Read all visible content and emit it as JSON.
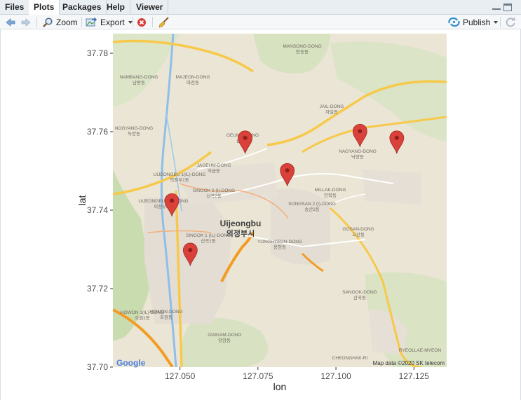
{
  "tabs": [
    {
      "label": "Files",
      "active": false
    },
    {
      "label": "Plots",
      "active": true
    },
    {
      "label": "Packages",
      "active": false
    },
    {
      "label": "Help",
      "active": false
    },
    {
      "label": "Viewer",
      "active": false
    }
  ],
  "toolbar": {
    "zoom_label": "Zoom",
    "export_label": "Export",
    "publish_label": "Publish"
  },
  "colors": {
    "map_land": "#ebe5d6",
    "road_major": "#f7c94b",
    "road_orange": "#f39c24",
    "river": "#8fbfe8",
    "park": "#c7dcae",
    "marker": "#d9413a",
    "publish_accent": "#2f8fd2"
  },
  "map": {
    "city_name": "Uijeongbu",
    "city_name_ko": "의정부시",
    "attribution": "Map data ©2020 SK telecom",
    "google_logo": "Google",
    "place_labels": [
      {
        "text": "MANSONG-DONG",
        "sub": "만송동"
      },
      {
        "text": "NAMBANG-DONG",
        "sub": "남방동"
      },
      {
        "text": "MAJEON-DONG",
        "sub": "마전동"
      },
      {
        "text": "JAIL-DONG",
        "sub": "자일동"
      },
      {
        "text": "NOGYANG-DONG",
        "sub": "녹양동"
      },
      {
        "text": "GEUMO-DONG",
        "sub": "금오동"
      },
      {
        "text": "NAGYANG-DONG",
        "sub": "낙양동"
      },
      {
        "text": "JAGEUM-DONG",
        "sub": "자금동"
      },
      {
        "text": "UIJEONGBU 1(IL)-DONG",
        "sub": "의정부1동"
      },
      {
        "text": "SINGOK 2 (I)-DONG",
        "sub": "신곡2동"
      },
      {
        "text": "MILLAK-DONG",
        "sub": "민락동"
      },
      {
        "text": "UIJEONGBU 2(I)-DONG",
        "sub": "의정부2동"
      },
      {
        "text": "SONGSAN 2 (I)-DONG",
        "sub": "송산2동"
      },
      {
        "text": "GOSAN-DONG",
        "sub": "고산동"
      },
      {
        "text": "SINGOK 1 (IL)-DONG",
        "sub": "신곡1동"
      },
      {
        "text": "YONGHYEON-DONG",
        "sub": "용현동"
      },
      {
        "text": "SANGOK-DONG",
        "sub": "산곡동"
      },
      {
        "text": "HOWON 1(IL)-DONG",
        "sub": "호원1동"
      },
      {
        "text": "HOWON-DONG",
        "sub": "호원동"
      },
      {
        "text": "JANGAM-DONG",
        "sub": "장암동"
      },
      {
        "text": "CHEONGHAK-RI",
        "sub": ""
      },
      {
        "text": "RYEOLLAE-MYEON",
        "sub": ""
      }
    ]
  },
  "chart_data": {
    "type": "scatter",
    "xlabel": "lon",
    "ylabel": "lat",
    "xlim": [
      127.0285,
      127.1355
    ],
    "ylim": [
      37.7,
      37.785
    ],
    "x_ticks": [
      127.05,
      127.075,
      127.1,
      127.125
    ],
    "x_tick_labels": [
      "127.050",
      "127.075",
      "127.100",
      "127.125"
    ],
    "y_ticks": [
      37.7,
      37.72,
      37.74,
      37.76,
      37.78
    ],
    "y_tick_labels": [
      "37.70",
      "37.72",
      "37.74",
      "37.76",
      "37.78"
    ],
    "points": [
      {
        "lon": 127.0709,
        "lat": 37.7545
      },
      {
        "lon": 127.0844,
        "lat": 37.7462
      },
      {
        "lon": 127.1077,
        "lat": 37.7562
      },
      {
        "lon": 127.1195,
        "lat": 37.7545
      },
      {
        "lon": 127.0474,
        "lat": 37.7385
      },
      {
        "lon": 127.0533,
        "lat": 37.7259
      }
    ]
  }
}
